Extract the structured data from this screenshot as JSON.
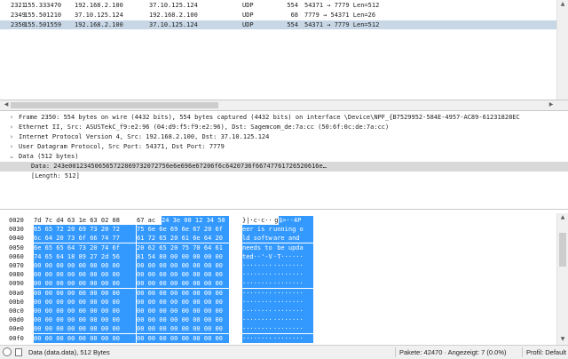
{
  "packet_list": {
    "rows": [
      {
        "no": "2321",
        "time": "155.333470",
        "src": "192.168.2.100",
        "dst": "37.10.125.124",
        "proto": "UDP",
        "len": "554",
        "info": "54371 → 7779 Len=512"
      },
      {
        "no": "2349",
        "time": "155.501210",
        "src": "37.10.125.124",
        "dst": "192.168.2.100",
        "proto": "UDP",
        "len": "68",
        "info": "7779 → 54371 Len=26"
      },
      {
        "no": "2350",
        "time": "155.501559",
        "src": "192.168.2.100",
        "dst": "37.10.125.124",
        "proto": "UDP",
        "len": "554",
        "info": "54371 → 7779 Len=512"
      }
    ]
  },
  "details": {
    "rows": [
      {
        "expander": "›",
        "text": "Frame 2350: 554 bytes on wire (4432 bits), 554 bytes captured (4432 bits) on interface \\Device\\NPF_{B7529952-584E-4957-AC89-61231828EC"
      },
      {
        "expander": "›",
        "text": "Ethernet II, Src: ASUSTekC_f9:e2:96 (04:d9:f5:f9:e2:96), Dst: Sagemcom_de:7a:cc (50:6f:0c:de:7a:cc)"
      },
      {
        "expander": "›",
        "text": "Internet Protocol Version 4, Src: 192.168.2.100, Dst: 37.10.125.124"
      },
      {
        "expander": "›",
        "text": "User Datagram Protocol, Src Port: 54371, Dst Port: 7779"
      },
      {
        "expander": "⌄",
        "text": "Data (512 bytes)"
      },
      {
        "expander": "",
        "text": "Data: 243e001234506565722069732072756e6e696e67206f6c6420736f66747761726520616e…"
      },
      {
        "expander": "",
        "text": "[Length: 512]"
      }
    ]
  },
  "hex": {
    "rows": [
      {
        "off": "0020",
        "b1": "7d 7c d4 63 1e 63 02 08",
        "b2a": "67 ac",
        "b2b": "24 3e 00 12 34 50",
        "a1": "}|·c·c··",
        "a2a": " g",
        "a2b": "$>··4P"
      },
      {
        "off": "0030",
        "b1": "65 65 72 20 69 73 20 72",
        "b2a": "",
        "b2b": "75 6e 6e 69 6e 67 20 6f",
        "a1": "eer is r",
        "a2a": "",
        "a2b": "unning o"
      },
      {
        "off": "0040",
        "b1": "6c 64 20 73 6f 66 74 77",
        "b2a": "",
        "b2b": "61 72 65 20 61 6e 64 20",
        "a1": "ld softw",
        "a2a": "",
        "a2b": "are and "
      },
      {
        "off": "0050",
        "b1": "6e 65 65 64 73 20 74 6f",
        "b2a": "",
        "b2b": "20 62 65 20 75 70 64 61",
        "a1": "needs to",
        "a2a": "",
        "a2b": " be upda"
      },
      {
        "off": "0060",
        "b1": "74 65 64 18 89 27 2d 56",
        "b2a": "",
        "b2b": "81 54 80 00 00 00 00 00",
        "a1": "ted··'-V",
        "a2a": "",
        "a2b": "·T······"
      },
      {
        "off": "0070",
        "b1": "00 00 00 00 00 00 00 00",
        "b2a": "",
        "b2b": "00 00 00 00 00 00 00 00",
        "a1": "········",
        "a2a": "",
        "a2b": "········"
      },
      {
        "off": "0080",
        "b1": "00 00 00 00 00 00 00 00",
        "b2a": "",
        "b2b": "00 00 00 00 00 00 00 00",
        "a1": "········",
        "a2a": "",
        "a2b": "········"
      },
      {
        "off": "0090",
        "b1": "00 00 00 00 00 00 00 00",
        "b2a": "",
        "b2b": "00 00 00 00 00 00 00 00",
        "a1": "········",
        "a2a": "",
        "a2b": "········"
      },
      {
        "off": "00a0",
        "b1": "00 00 00 00 00 00 00 00",
        "b2a": "",
        "b2b": "00 00 00 00 00 00 00 00",
        "a1": "········",
        "a2a": "",
        "a2b": "········"
      },
      {
        "off": "00b0",
        "b1": "00 00 00 00 00 00 00 00",
        "b2a": "",
        "b2b": "00 00 00 00 00 00 00 00",
        "a1": "········",
        "a2a": "",
        "a2b": "········"
      },
      {
        "off": "00c0",
        "b1": "00 00 00 00 00 00 00 00",
        "b2a": "",
        "b2b": "00 00 00 00 00 00 00 00",
        "a1": "········",
        "a2a": "",
        "a2b": "········"
      },
      {
        "off": "00d0",
        "b1": "00 00 00 00 00 00 00 00",
        "b2a": "",
        "b2b": "00 00 00 00 00 00 00 00",
        "a1": "········",
        "a2a": "",
        "a2b": "········"
      },
      {
        "off": "00e0",
        "b1": "00 00 00 00 00 00 00 00",
        "b2a": "",
        "b2b": "00 00 00 00 00 00 00 00",
        "a1": "········",
        "a2a": "",
        "a2b": "········"
      },
      {
        "off": "00f0",
        "b1": "00 00 00 00 00 00 00 00",
        "b2a": "",
        "b2b": "00 00 00 00 00 00 00 00",
        "a1": "········",
        "a2a": "",
        "a2b": "········"
      }
    ]
  },
  "status": {
    "field": "Data (data.data), 512 Bytes",
    "packets": "Pakete: 42470 · Angezeigt: 7 (0.0%)",
    "profile": "Profil: Default"
  },
  "colors": {
    "selection": "#c8d7e6",
    "hex_highlight": "#3399ff",
    "detail_selection": "#d9d9d9"
  }
}
